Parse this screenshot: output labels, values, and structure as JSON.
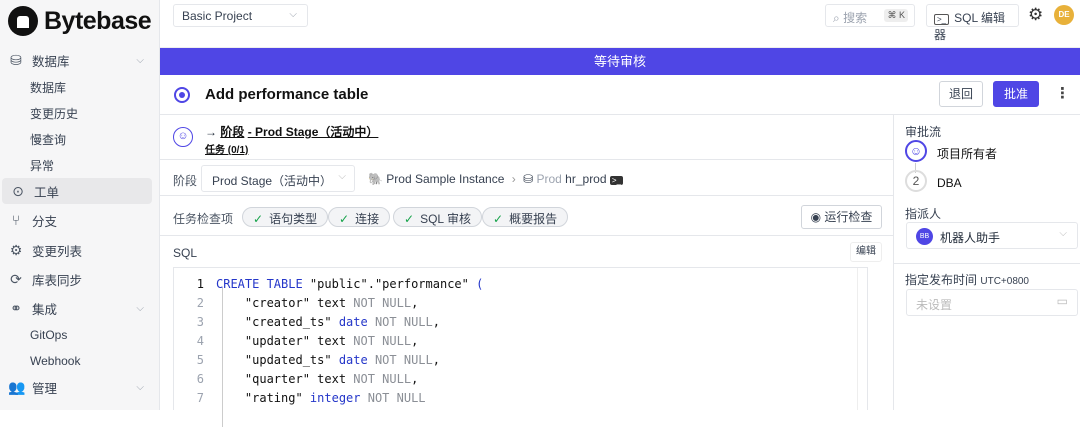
{
  "brand": "Bytebase",
  "sidebar": {
    "items": [
      {
        "label": "数据库",
        "type": "top",
        "icon": "database-icon",
        "chevron": true
      },
      {
        "label": "数据库",
        "type": "sub"
      },
      {
        "label": "变更历史",
        "type": "sub"
      },
      {
        "label": "慢查询",
        "type": "sub"
      },
      {
        "label": "异常",
        "type": "sub"
      },
      {
        "label": "工单",
        "type": "top",
        "icon": "issue-icon",
        "active": true
      },
      {
        "label": "分支",
        "type": "top",
        "icon": "branch-icon"
      },
      {
        "label": "变更列表",
        "type": "top",
        "icon": "changelist-icon"
      },
      {
        "label": "库表同步",
        "type": "top",
        "icon": "sync-icon"
      },
      {
        "label": "集成",
        "type": "top",
        "icon": "link-icon",
        "chevron": true
      },
      {
        "label": "GitOps",
        "type": "sub"
      },
      {
        "label": "Webhook",
        "type": "sub"
      },
      {
        "label": "管理",
        "type": "top",
        "icon": "users-icon",
        "chevron": true
      }
    ]
  },
  "header": {
    "project": "Basic Project",
    "search_placeholder": "搜索",
    "search_shortcut": "⌘ K",
    "sql_editor": "SQL 编辑器",
    "avatar": "DE"
  },
  "banner": "等待审核",
  "issue": {
    "title": "Add performance table",
    "reject": "退回",
    "approve": "批准"
  },
  "stage": {
    "arrow": "→",
    "stage_label": "阶段",
    "stage_name": "- Prod Stage（活动中）",
    "tasks": "任务 (0/1)"
  },
  "selector": {
    "label": "阶段",
    "value": "Prod Stage（活动中）",
    "instance": "Prod Sample Instance",
    "env": "Prod",
    "database": "hr_prod"
  },
  "checks": {
    "label": "任务检查项",
    "items": [
      "语句类型",
      "连接",
      "SQL 审核",
      "概要报告"
    ],
    "run": "运行检查"
  },
  "sql": {
    "label": "SQL",
    "edit": "编辑",
    "lines": [
      [
        [
          "kw",
          "CREATE TABLE "
        ],
        [
          "pl",
          "\"public\".\"performance\" "
        ],
        [
          "kw",
          "("
        ]
      ],
      [
        [
          "pl",
          "    \"creator\" text "
        ],
        [
          "nl",
          "NOT NULL"
        ],
        [
          "pl",
          ","
        ]
      ],
      [
        [
          "pl",
          "    \"created_ts\" "
        ],
        [
          "kw",
          "date "
        ],
        [
          "nl",
          "NOT NULL"
        ],
        [
          "pl",
          ","
        ]
      ],
      [
        [
          "pl",
          "    \"updater\" text "
        ],
        [
          "nl",
          "NOT NULL"
        ],
        [
          "pl",
          ","
        ]
      ],
      [
        [
          "pl",
          "    \"updated_ts\" "
        ],
        [
          "kw",
          "date "
        ],
        [
          "nl",
          "NOT NULL"
        ],
        [
          "pl",
          ","
        ]
      ],
      [
        [
          "pl",
          "    \"quarter\" text "
        ],
        [
          "nl",
          "NOT NULL"
        ],
        [
          "pl",
          ","
        ]
      ],
      [
        [
          "pl",
          "    \"rating\" "
        ],
        [
          "kw",
          "integer "
        ],
        [
          "nl",
          "NOT NULL"
        ]
      ]
    ]
  },
  "right": {
    "flow_label": "审批流",
    "steps": [
      {
        "num": "",
        "name": "项目所有者"
      },
      {
        "num": "2",
        "name": "DBA"
      }
    ],
    "assignee_label": "指派人",
    "assignee_avatar": "BB",
    "assignee": "机器人助手",
    "schedule_label": "指定发布时间",
    "timezone": "UTC+0800",
    "schedule_placeholder": "未设置"
  },
  "colors": {
    "accent": "#4f46e5",
    "avatar": "#e8b13a"
  }
}
